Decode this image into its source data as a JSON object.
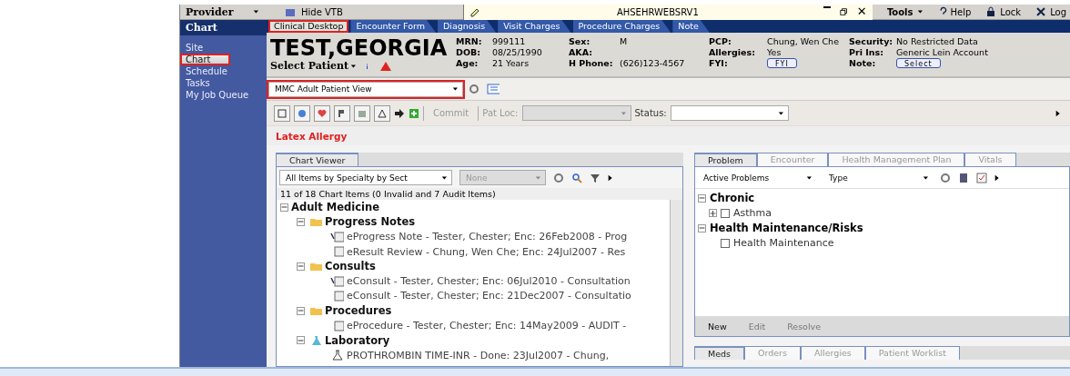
{
  "nav": {
    "role": "Provider",
    "title": "Chart",
    "items": [
      {
        "label": "Site",
        "selected": false,
        "highlighted": false
      },
      {
        "label": "Chart",
        "selected": true,
        "highlighted": true
      },
      {
        "label": "Schedule",
        "selected": false,
        "highlighted": false
      },
      {
        "label": "Tasks",
        "selected": false,
        "highlighted": false
      },
      {
        "label": "My Job Queue",
        "selected": false,
        "highlighted": false
      }
    ]
  },
  "topbar": {
    "hide_label": "Hide VTB",
    "server": "AHSEHRWEBSRV1",
    "menus": [
      {
        "kind": "tools",
        "label": "Tools"
      },
      {
        "kind": "help",
        "label": "Help"
      },
      {
        "kind": "lock",
        "label": "Lock"
      },
      {
        "kind": "logoff",
        "label": "Log"
      }
    ]
  },
  "tabs": [
    {
      "label": "Clinical Desktop",
      "selected": true,
      "highlighted": true
    },
    {
      "label": "Encounter Form",
      "selected": false,
      "highlighted": false
    },
    {
      "label": "Diagnosis",
      "selected": false,
      "highlighted": false
    },
    {
      "label": "Visit Charges",
      "selected": false,
      "highlighted": false
    },
    {
      "label": "Procedure Charges",
      "selected": false,
      "highlighted": false
    },
    {
      "label": "Note",
      "selected": false,
      "highlighted": false
    }
  ],
  "patient": {
    "name": "TEST,GEORGIA",
    "select_label": "Select Patient",
    "columns": [
      [
        {
          "label": "MRN:",
          "value": "999111"
        },
        {
          "label": "DOB:",
          "value": "08/25/1990"
        },
        {
          "label": "Age:",
          "value": "21 Years"
        }
      ],
      [
        {
          "label": "Sex:",
          "value": "M"
        },
        {
          "label": "AKA:"
        },
        {
          "label": "H Phone:",
          "value": "(626)123-4567"
        }
      ],
      [
        {
          "label": "PCP:",
          "value": "Chung, Wen Che"
        },
        {
          "label": "Allergies:",
          "value": "Yes"
        },
        {
          "label": "FYI:",
          "button": "FYI"
        }
      ],
      [
        {
          "label": "Security:",
          "value": "No Restricted Data"
        },
        {
          "label": "Pri Ins:",
          "value": "Generic Lein Account"
        },
        {
          "label": "Note:",
          "button": "Select"
        }
      ]
    ]
  },
  "view": {
    "value": "MMC Adult Patient View",
    "highlighted": true
  },
  "toolbar": {
    "commit": "Commit",
    "pat_loc": "Pat Loc:",
    "status": "Status:"
  },
  "alert": "Latex Allergy",
  "chart_viewer": {
    "tab": "Chart Viewer",
    "filter": "All Items by Specialty by Sect",
    "filter2": "None",
    "count": "11 of 18 Chart Items (0 Invalid and 7 Audit Items)",
    "tree": [
      {
        "kind": "group",
        "label": "Adult Medicine",
        "children": [
          {
            "kind": "folder",
            "label": "Progress Notes",
            "children": [
              {
                "kind": "note",
                "signed": true,
                "label": "eProgress Note - Tester, Chester; Enc: 26Feb2008 - Prog"
              },
              {
                "kind": "note",
                "signed": false,
                "label": "eResult Review - Chung, Wen Che; Enc: 24Jul2007 - Res"
              }
            ]
          },
          {
            "kind": "folder",
            "label": "Consults",
            "children": [
              {
                "kind": "note",
                "signed": true,
                "label": "eConsult - Tester, Chester; Enc: 06Jul2010 - Consultation"
              },
              {
                "kind": "note",
                "signed": false,
                "label": "eConsult - Tester, Chester; Enc: 21Dec2007 - Consultatio"
              }
            ]
          },
          {
            "kind": "folder",
            "label": "Procedures",
            "children": [
              {
                "kind": "note",
                "signed": false,
                "label": "eProcedure - Tester, Chester; Enc: 14May2009 - AUDIT -"
              }
            ]
          },
          {
            "kind": "lab",
            "label": "Laboratory",
            "children": [
              {
                "kind": "result",
                "label": "PROTHROMBIN TIME-INR - Done: 23Jul2007 - Chung,"
              }
            ]
          }
        ]
      }
    ]
  },
  "problems": {
    "tabs": [
      {
        "label": "Problem",
        "selected": true
      },
      {
        "label": "Encounter",
        "selected": false
      },
      {
        "label": "Health Management Plan",
        "selected": false
      },
      {
        "label": "Vitals",
        "selected": false
      }
    ],
    "filter": "Active Problems",
    "filter2": "Type",
    "tree": [
      {
        "label": "Chronic",
        "children": [
          {
            "label": "Asthma",
            "checked": false,
            "expandable": true
          }
        ]
      },
      {
        "label": "Health Maintenance/Risks",
        "children": [
          {
            "label": "Health Maintenance",
            "checked": false,
            "expandable": false
          }
        ]
      }
    ],
    "actions": [
      {
        "label": "New",
        "disabled": false
      },
      {
        "label": "Edit",
        "disabled": true
      },
      {
        "label": "Resolve",
        "disabled": true
      }
    ]
  },
  "bottom_tabs": [
    {
      "label": "Meds",
      "selected": true
    },
    {
      "label": "Orders",
      "selected": false
    },
    {
      "label": "Allergies",
      "selected": false
    },
    {
      "label": "Patient Worklist",
      "selected": false
    }
  ]
}
